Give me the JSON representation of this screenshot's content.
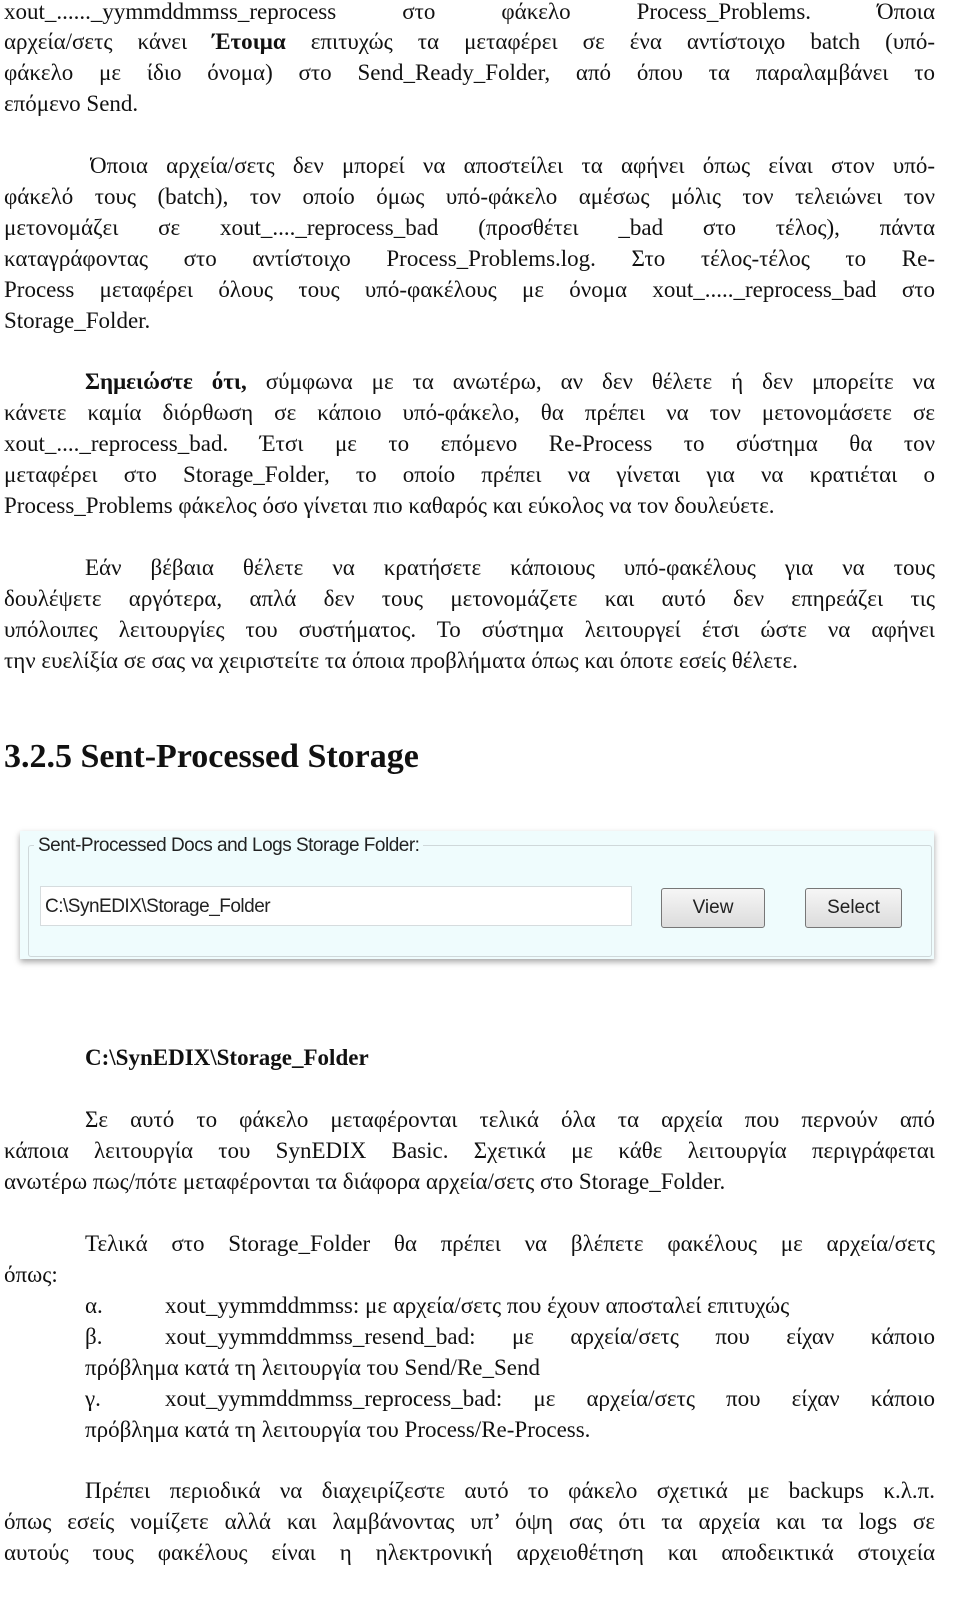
{
  "p1": {
    "l0": "xout_......_yymmddmmss_reprocess στο φάκελο Process_Problems. Όποια",
    "l1a": "αρχεία/σετς κάνει ",
    "l1b": "Έτοιμα",
    "l1c": " επιτυχώς τα μεταφέρει σε ένα αντίστοιχο batch (υπό-",
    "l2": "φάκελο με ίδιο όνομα) στο Send_Ready_Folder, από όπου τα παραλαμβάνει το",
    "l3": "επόμενο Send."
  },
  "p2": [
    "Όποια αρχεία/σετς δεν μπορεί να αποστείλει τα αφήνει όπως είναι στον υπό-",
    "φάκελό τους (batch), τον οποίο όμως υπό-φάκελο αμέσως μόλις τον τελειώνει τον",
    "μετονομάζει σε xout_...._reprocess_bad (προσθέτει _bad στο τέλος), πάντα",
    "καταγράφοντας στο αντίστοιχο Process_Problems.log. Στο τέλος-τέλος το Re-",
    "Process μεταφέρει όλους τους υπό-φακέλους με όνομα xout_....._reprocess_bad στο",
    "Storage_Folder."
  ],
  "p3": {
    "l0a": "Σημειώστε ότι,",
    "l0b": " σύμφωνα με τα ανωτέρω, αν δεν θέλετε ή δεν μπορείτε να",
    "l1": "κάνετε καμία διόρθωση σε κάποιο υπό-φάκελο, θα πρέπει να τον μετονομάσετε σε",
    "l2": "xout_...._reprocess_bad. Έτσι με το επόμενο Re-Process το σύστημα θα τον",
    "l3": "μεταφέρει στο Storage_Folder, το οποίο πρέπει να γίνεται για να κρατιέται ο",
    "l4": "Process_Problems φάκελος όσο γίνεται πιο καθαρός και εύκολος να τον δουλεύετε."
  },
  "p4": [
    "Εάν βέβαια θέλετε να κρατήσετε κάποιους υπό-φακέλους για να τους",
    "δουλέψετε αργότερα, απλά δεν τους μετονομάζετε και αυτό δεν επηρεάζει τις",
    "υπόλοιπες λειτουργίες του συστήματος. Το σύστημα λειτουργεί έτσι ώστε να αφήνει",
    "την ευελίξία σε σας να χειριστείτε τα όποια προβλήματα όπως και όποτε εσείς θέλετε."
  ],
  "section_heading": "3.2.5 Sent-Processed Storage",
  "panel": {
    "legend": "Sent-Processed Docs and Logs Storage Folder:",
    "path_value": "C:\\SynEDIX\\Storage_Folder",
    "view_label": "View",
    "select_label": "Select"
  },
  "folder_heading": "C:\\SynEDIX\\Storage_Folder",
  "p5": [
    "Σε αυτό το φάκελο μεταφέρονται τελικά όλα τα αρχεία που περνούν από",
    "κάποια λειτουργία του SynEDIX Basic. Σχετικά με κάθε λειτουργία περιγράφεται",
    "ανωτέρω πως/πότε μεταφέρονται τα διάφορα αρχεία/σετς στο Storage_Folder."
  ],
  "p6": [
    "Τελικά στο Storage_Folder θα πρέπει να βλέπετε φακέλους με αρχεία/σετς",
    "όπως:"
  ],
  "list": [
    {
      "marker": "α.",
      "text": "xout_yymmddmmss: με αρχεία/σετς που έχουν αποσταλεί επιτυχώς"
    },
    {
      "marker": "β.",
      "text": "xout_yymmddmmss_resend_bad: με αρχεία/σετς που είχαν κάποιο",
      "cont": "πρόβλημα κατά τη λειτουργία του Send/Re_Send"
    },
    {
      "marker": "γ.",
      "text": "xout_yymmddmmss_reprocess_bad: με αρχεία/σετς που είχαν κάποιο",
      "cont": "πρόβλημα κατά τη λειτουργία του Process/Re-Process."
    }
  ],
  "p7": [
    "Πρέπει περιοδικά να διαχειρίζεστε αυτό το φάκελο σχετικά με backups κ.λ.π.",
    "όπως εσείς νομίζετε αλλά και λαμβάνοντας υπ’ όψη σας ότι τα αρχεία και τα logs σε",
    "αυτούς τους φακέλους είναι η ηλεκτρονική αρχειοθέτηση και αποδεικτικά στοιχεία"
  ]
}
